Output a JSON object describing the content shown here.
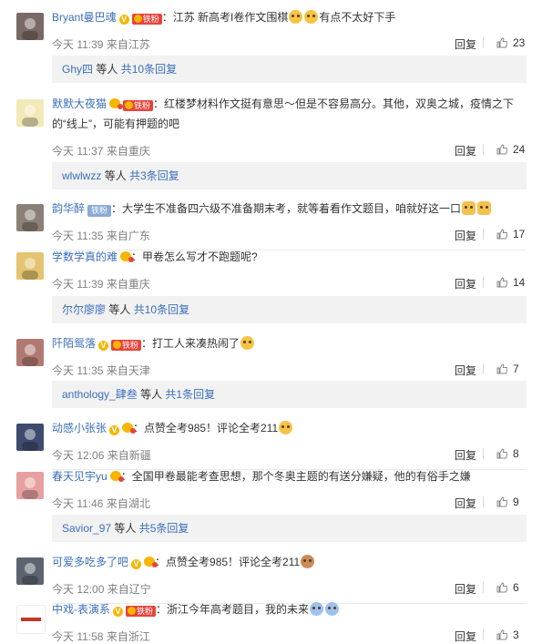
{
  "reply_label": "回复",
  "more_label": "等人",
  "comments": [
    {
      "user": "Bryant曼巴魂",
      "user_color": "blue",
      "badges": [
        "v",
        "fan"
      ],
      "text": "：江苏 新高考I卷作文围棋",
      "emojis_after": [
        "emoji-lol",
        "emoji-lol"
      ],
      "text_after": "有点不太好下手",
      "time": "今天 11:39",
      "location": "来自江苏",
      "likes": "23",
      "reply_bar": {
        "user": "Ghy四",
        "count_text": "共10条回复"
      }
    },
    {
      "user": "默默大夜猫",
      "user_color": "blue",
      "badges": [
        "heart",
        "fan"
      ],
      "text": "：红楼梦材料作文挺有意思～但是不容易高分。其他，双奥之城，疫情之下的“线上”，可能有押题的吧",
      "time": "今天 11:37",
      "location": "来自重庆",
      "likes": "24",
      "reply_bar": {
        "user": "wlwlwzz",
        "count_text": "共3条回复"
      }
    },
    {
      "user": "韵华醉",
      "user_color": "blue",
      "badges": [
        "tie"
      ],
      "tie_label": "铁粉",
      "text": "：大学生不准备四六级不准备期末考，就等着看作文题目，咱就好这一口",
      "emojis_after": [
        "emoji-cat",
        "emoji-cat"
      ],
      "time": "今天 11:35",
      "location": "来自广东",
      "likes": "17"
    },
    {
      "user": "学数学真的难",
      "user_color": "blue",
      "badges": [
        "heart"
      ],
      "text": "：甲卷怎么写才不跑题呢?",
      "time": "今天 11:39",
      "location": "来自重庆",
      "likes": "14",
      "reply_bar": {
        "user": "尔尔廖廖",
        "count_text": "共10条回复"
      }
    },
    {
      "user": "阡陌鸳落",
      "user_color": "blue",
      "badges": [
        "v",
        "fan"
      ],
      "text": "：打工人来凑热闹了",
      "emojis_after": [
        "emoji-laugh"
      ],
      "time": "今天 11:35",
      "location": "来自天津",
      "likes": "7",
      "reply_bar": {
        "user": "anthology_肆叁",
        "count_text": "共1条回复"
      }
    },
    {
      "user": "动感小张张",
      "user_color": "blue",
      "badges": [
        "v",
        "heart"
      ],
      "text": "：点赞全考985！评论全考211",
      "emojis_after": [
        "emoji-grin"
      ],
      "time": "今天 12:06",
      "location": "来自新疆",
      "likes": "8"
    },
    {
      "user": "春天见宇yu",
      "user_color": "blue",
      "badges": [
        "heart"
      ],
      "text": "：全国甲卷最能考查思想，那个冬奥主题的有送分嫌疑，他的有俗手之嫌",
      "time": "今天 11:46",
      "location": "来自湖北",
      "likes": "9",
      "reply_bar": {
        "user": "Savior_97",
        "count_text": "共5条回复"
      }
    },
    {
      "user": "可爱多吃多了吧",
      "user_color": "blue",
      "badges": [
        "v",
        "heart"
      ],
      "text": "：点赞全考985！评论全考211",
      "emojis_after": [
        "emoji-pray"
      ],
      "time": "今天 12:00",
      "location": "来自辽宁",
      "likes": "6"
    },
    {
      "user": "中戏-表演系",
      "user_color": "blue",
      "badges": [
        "v",
        "fan"
      ],
      "text": "：浙江今年高考题目，我的未来",
      "emojis_after": [
        "emoji-lol",
        "emoji-lol"
      ],
      "time": "今天 11:58",
      "location": "来自浙江",
      "likes": "3"
    }
  ],
  "fan_label": "铁粉"
}
